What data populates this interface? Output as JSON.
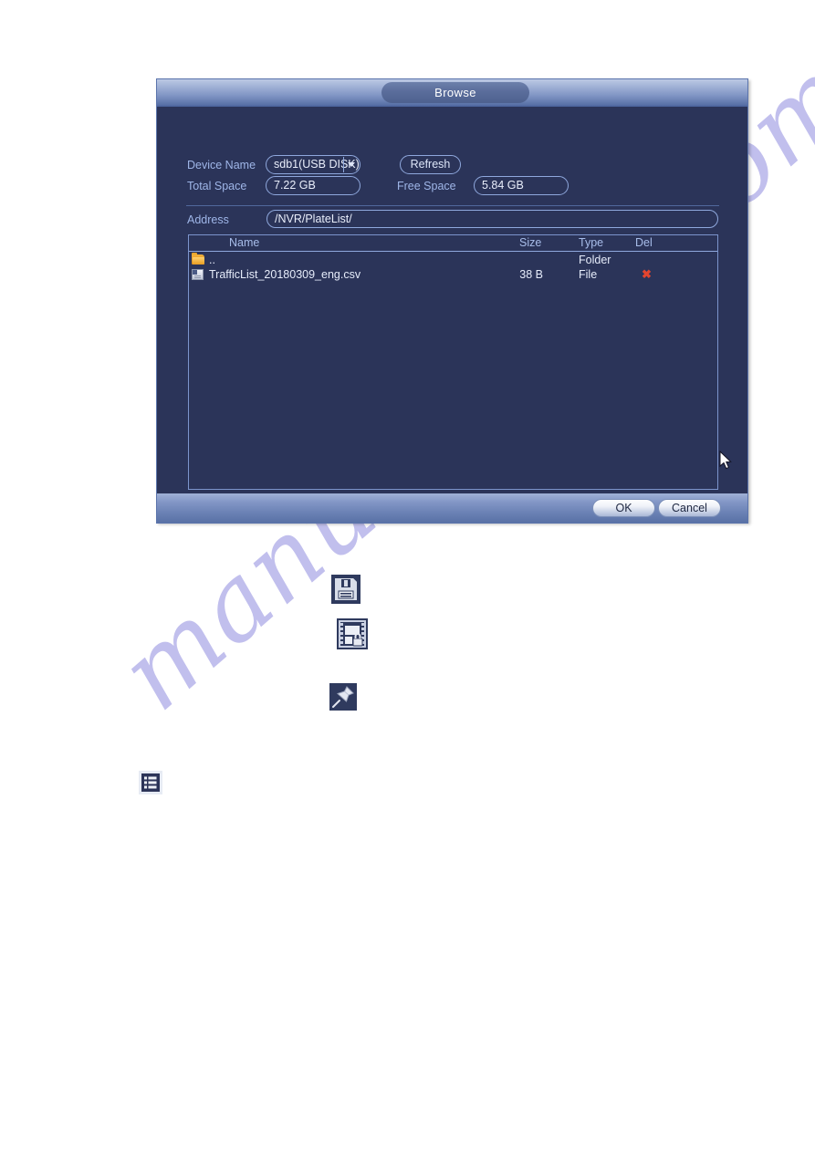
{
  "dialog": {
    "title": "Browse",
    "fields": {
      "device_name_label": "Device Name",
      "device_name_value": "sdb1(USB DISK)",
      "refresh_label": "Refresh",
      "total_space_label": "Total Space",
      "total_space_value": "7.22 GB",
      "free_space_label": "Free Space",
      "free_space_value": "5.84 GB",
      "address_label": "Address",
      "address_value": "/NVR/PlateList/"
    },
    "file_list": {
      "columns": [
        "Name",
        "Size",
        "Type",
        "Del"
      ],
      "rows": [
        {
          "name": "..",
          "size": "",
          "type": "Folder",
          "del": "",
          "icon": "folder-icon"
        },
        {
          "name": "TrafficList_20180309_eng.csv",
          "size": "38 B",
          "type": "File",
          "del": "✖",
          "icon": "file-icon"
        }
      ]
    },
    "footer": {
      "ok_label": "OK",
      "cancel_label": "Cancel"
    }
  },
  "page_icons": [
    {
      "name": "save-floppy-icon"
    },
    {
      "name": "video-lock-icon"
    },
    {
      "name": "pushpin-mark-icon"
    },
    {
      "name": "list-menu-icon"
    }
  ],
  "watermark": {
    "text": "manualshive.com"
  },
  "colors": {
    "dialog_body": "#2b3459",
    "field_border": "#8fa8dd",
    "label_text": "#9fb6e8",
    "delete_x": "#e2452f",
    "folder_icon": "#e8a52e",
    "watermark": "#7670d6"
  }
}
